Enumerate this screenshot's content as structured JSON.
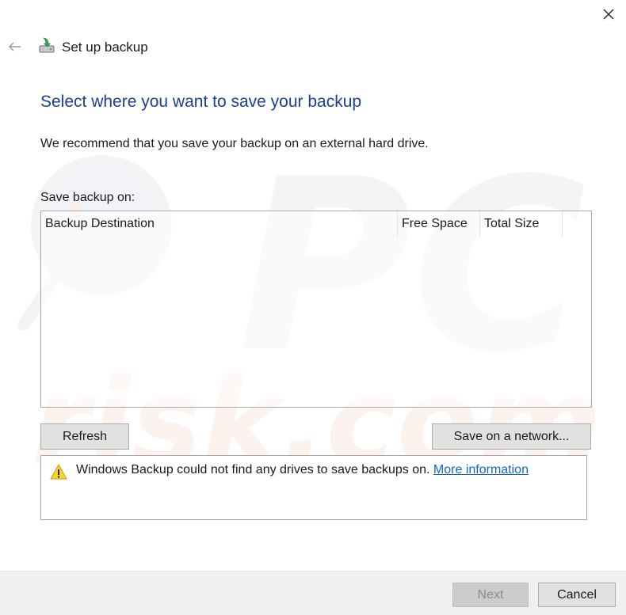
{
  "window": {
    "title": "Set up backup",
    "close_icon": "close-icon",
    "back_icon": "back-arrow-icon",
    "app_icon": "backup-drive-icon"
  },
  "main": {
    "heading": "Select where you want to save your backup",
    "recommendation": "We recommend that you save your backup on an external hard drive.",
    "save_on_label": "Save backup on:",
    "destination_list": {
      "columns": [
        "Backup Destination",
        "Free Space",
        "Total Size"
      ],
      "rows": []
    },
    "refresh_label": "Refresh",
    "save_network_label": "Save on a network...",
    "warning": {
      "icon": "warning-icon",
      "message": "Windows Backup could not find any drives to save backups on.",
      "link_text": "More information"
    }
  },
  "footer": {
    "next_label": "Next",
    "cancel_label": "Cancel"
  },
  "watermark": {
    "text_top": "PC",
    "text_bottom": "risk.com"
  },
  "colors": {
    "heading": "#1c3f94",
    "link": "#1565c0",
    "footer_bg": "#f0f0f0",
    "button_bg": "#e1e1e1",
    "disabled_button_bg": "#cccccc"
  }
}
